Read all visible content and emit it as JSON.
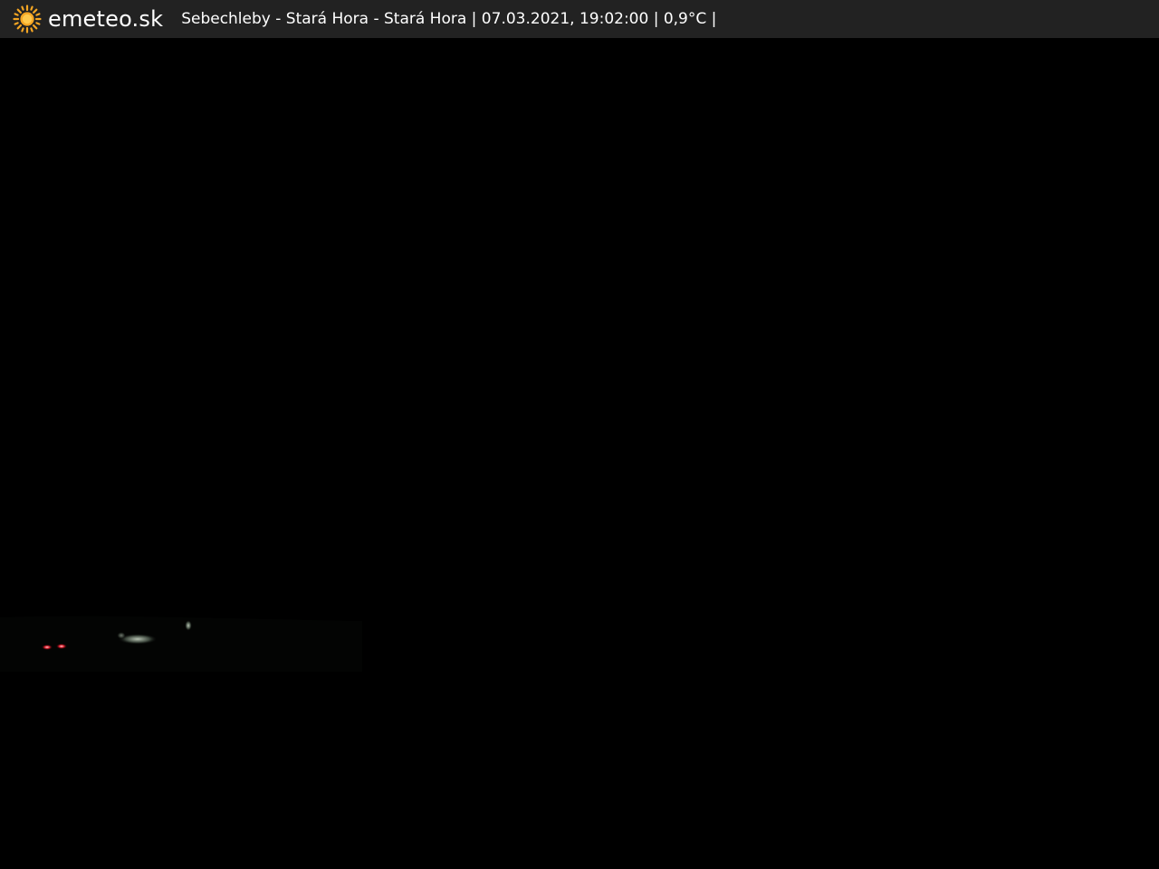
{
  "header": {
    "logo_icon": "sun-icon",
    "brand": "emeteo.sk",
    "caption": "Sebechleby - Stará Hora - Stará Hora | 07.03.2021, 19:02:00 | 0,9°C |",
    "background_color": "#222222",
    "text_color": "#ffffff",
    "sun_color": "#f5a623"
  },
  "webcam": {
    "scene": "night",
    "background_color": "#000000"
  }
}
